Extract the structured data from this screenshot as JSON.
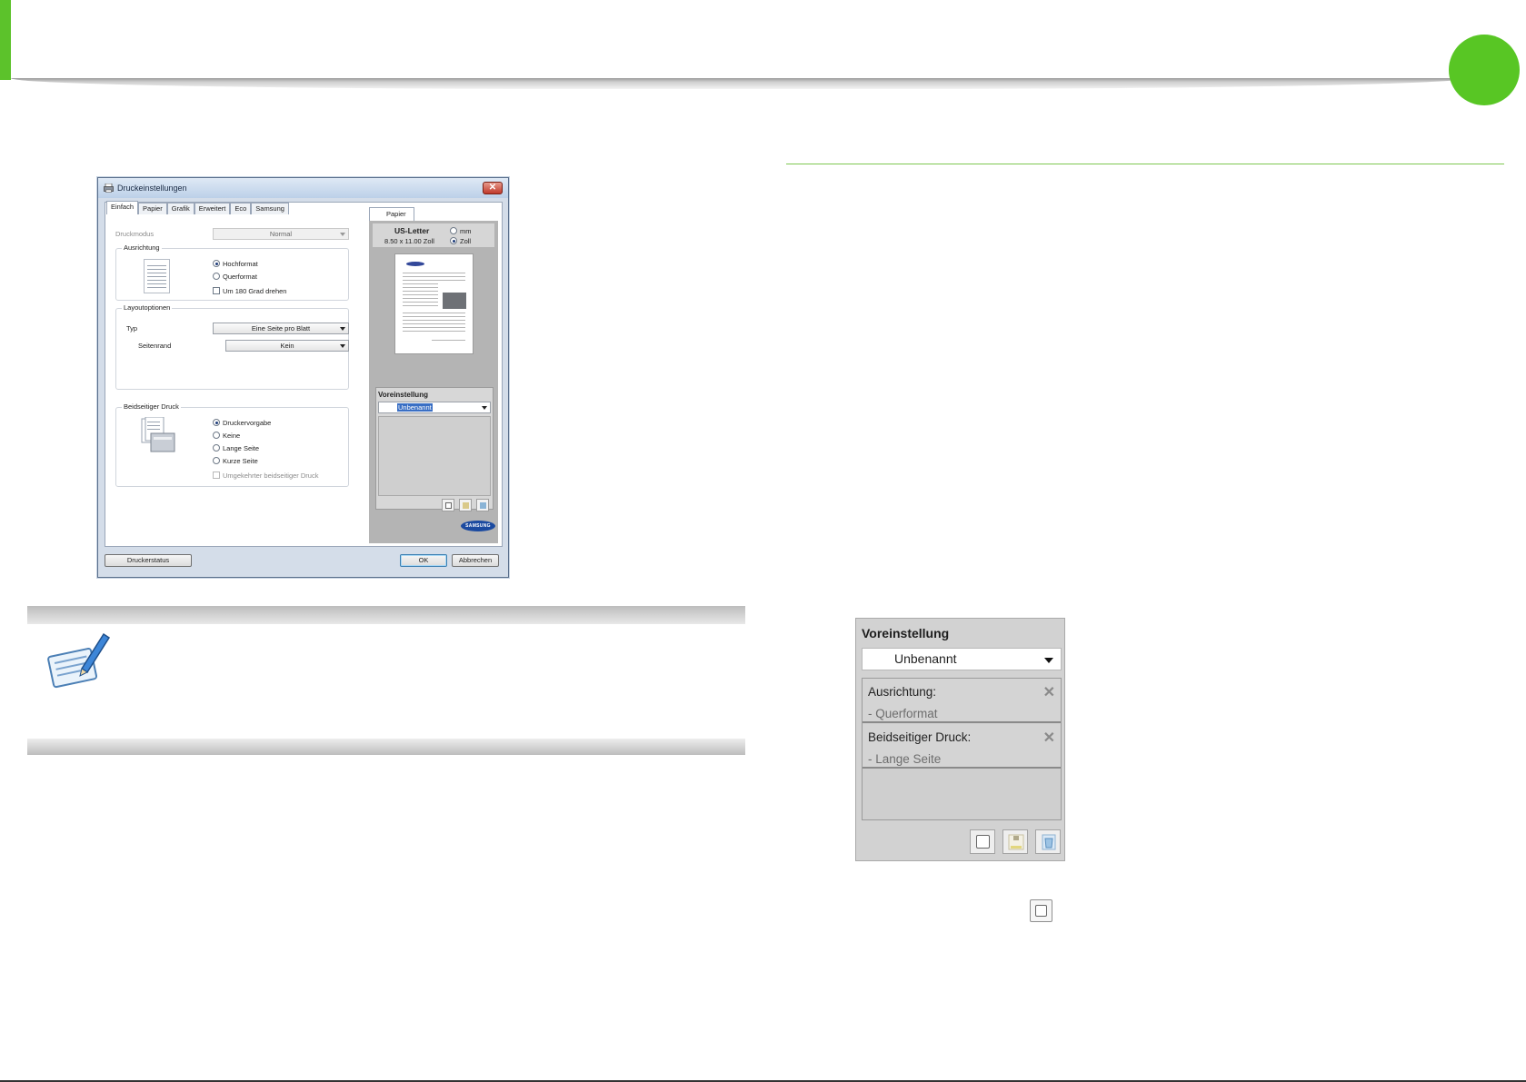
{
  "dialog": {
    "title": "Druckeinstellungen",
    "close_glyph": "✕",
    "tabs": [
      "Einfach",
      "Papier",
      "Grafik",
      "Erweitert",
      "Eco",
      "Samsung"
    ],
    "active_tab": "Einfach",
    "druckmodus": {
      "label": "Druckmodus",
      "value": "Normal"
    },
    "ausrichtung": {
      "title": "Ausrichtung",
      "options": [
        "Hochformat",
        "Querformat"
      ],
      "selected": "Hochformat",
      "rotate_label": "Um 180 Grad drehen"
    },
    "layout": {
      "title": "Layoutoptionen",
      "typ_label": "Typ",
      "typ_value": "Eine Seite pro Blatt",
      "seitenrand_label": "Seitenrand",
      "seitenrand_value": "Kein"
    },
    "duplex": {
      "title": "Beidseitiger Druck",
      "options": [
        "Druckervorgabe",
        "Keine",
        "Lange Seite",
        "Kurze Seite"
      ],
      "selected": "Druckervorgabe",
      "reverse_label": "Umgekehrter beidseitiger Druck"
    },
    "preview": {
      "tab_label": "Papier",
      "paper_name": "US-Letter",
      "paper_size": "8.50 x 11.00 Zoll",
      "units": [
        "mm",
        "Zoll"
      ],
      "selected_unit": "Zoll",
      "preset_title": "Voreinstellung",
      "preset_value": "Unbenannt",
      "logo_text": "SAMSUNG"
    },
    "buttons": {
      "status": "Druckerstatus",
      "ok": "OK",
      "cancel": "Abbrechen"
    }
  },
  "preset_panel": {
    "title": "Voreinstellung",
    "value": "Unbenannt",
    "items": [
      {
        "head": "Ausrichtung:",
        "value": "- Querformat"
      },
      {
        "head": "Beidseitiger Druck:",
        "value": "- Lange Seite"
      }
    ],
    "remove_glyph": "✕"
  },
  "colors": {
    "accent_green": "#5cc22b",
    "dialog_frame": "#5a6f8c",
    "panel_gray": "#d2d2d2"
  }
}
